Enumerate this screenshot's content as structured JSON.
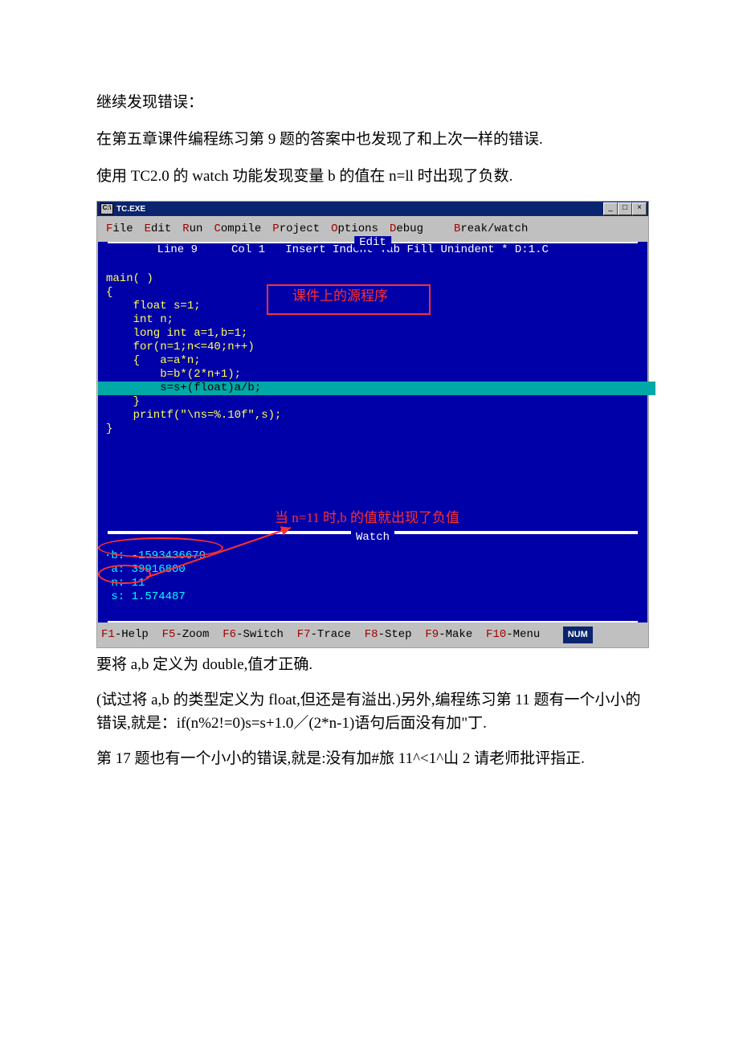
{
  "intro": {
    "p1": "继续发现错误：",
    "p2": "在第五章课件编程练习第 9 题的答案中也发现了和上次一样的错误.",
    "p3": "使用 TC2.0 的 watch 功能发现变量 b 的值在 n=ll 时出现了负数."
  },
  "window": {
    "title": "TC.EXE",
    "buttons": {
      "min": "_",
      "max": "□",
      "close": "×"
    }
  },
  "menu": [
    "File",
    "Edit",
    "Run",
    "Compile",
    "Project",
    "Options",
    "Debug",
    "Break/watch"
  ],
  "editor": {
    "frame_title": "Edit",
    "status": "    Line 9     Col 1   Insert Indent Tab Fill Unindent * D:1.C",
    "code": {
      "l1": "main( )",
      "l2": "{",
      "l3": "    float s=1;",
      "l4": "    int n;",
      "l5": "    long int a=1,b=1;",
      "l6": "    for(n=1;n<=40;n++)",
      "l7": "    {   a=a*n;",
      "l8": "        b=b*(2*n+1);",
      "hl": "        s=s+(float)a/b;",
      "l9": "    }",
      "l10": "    printf(\"\\ns=%.10f\",s);",
      "l11": "}"
    }
  },
  "annotations": {
    "a1": "课件上的源程序",
    "a2": "当 n=11 时,b 的值就出现了负值"
  },
  "watch": {
    "frame_title": "Watch",
    "lines": {
      "b": "·b: -1593436679",
      "a": " a: 39916800",
      "n": " n: 11",
      "s": " s: 1.574487"
    }
  },
  "fkeys": {
    "f1": "F1-Help",
    "f5": "F5-Zoom",
    "f6": "F6-Switch",
    "f7": "F7-Trace",
    "f8": "F8-Step",
    "f9": "F9-Make",
    "f10": "F10-Menu",
    "num": "NUM"
  },
  "outro": {
    "p1": "要将 a,b 定义为 double,值才正确.",
    "p2": "(试过将 a,b 的类型定义为 float,但还是有溢出.)另外,编程练习第 11 题有一个小小的错误,就是：if(n%2!=0)s=s+1.0／(2*n-1)语句后面没有加\"丁.",
    "p3": "第 17 题也有一个小小的错误,就是:没有加#旅 11^<1^山 2 请老师批评指正."
  }
}
